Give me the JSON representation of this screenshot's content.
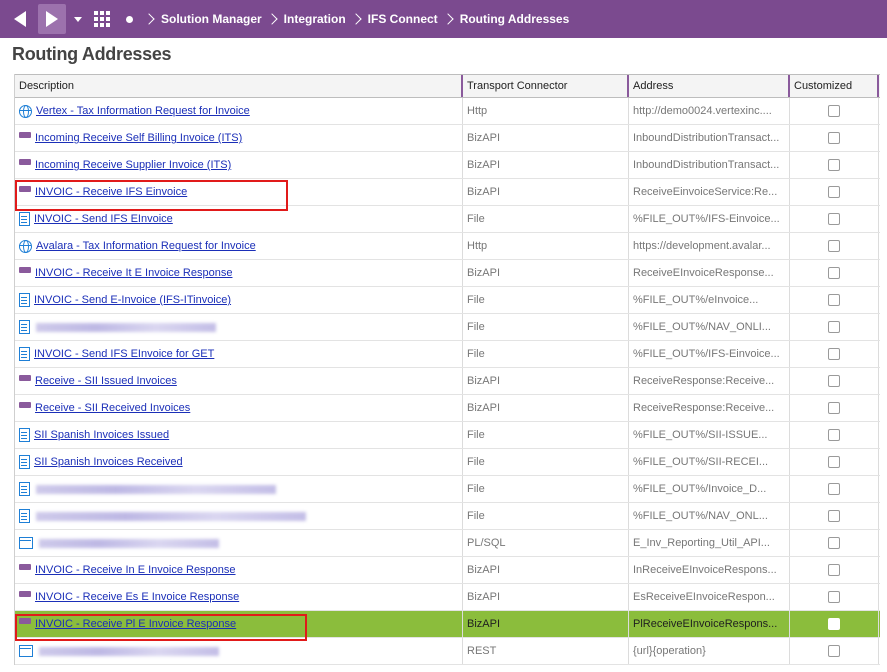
{
  "breadcrumb": [
    "Solution Manager",
    "Integration",
    "IFS Connect",
    "Routing Addresses"
  ],
  "page_title": "Routing Addresses",
  "columns": [
    "Description",
    "Transport Connector",
    "Address",
    "Customized"
  ],
  "rows": [
    {
      "icon": "globe-icon",
      "description": "Vertex - Tax Information Request for Invoice",
      "connector": "Http",
      "address": "http://demo0024.vertexinc...."
    },
    {
      "icon": "message-icon",
      "description": "Incoming Receive Self Billing Invoice (ITS)",
      "connector": "BizAPI",
      "address": "InboundDistributionTransact..."
    },
    {
      "icon": "message-icon",
      "description": "Incoming Receive Supplier Invoice (ITS)",
      "connector": "BizAPI",
      "address": "InboundDistributionTransact..."
    },
    {
      "icon": "message-icon",
      "description": "INVOIC - Receive IFS Einvoice",
      "connector": "BizAPI",
      "address": "ReceiveEinvoiceService:Re..."
    },
    {
      "icon": "file-icon",
      "description": "INVOIC - Send IFS EInvoice",
      "connector": "File",
      "address": "%FILE_OUT%/IFS-Einvoice..."
    },
    {
      "icon": "globe-icon",
      "description": "Avalara - Tax Information Request for Invoice",
      "connector": "Http",
      "address": "https://development.avalar..."
    },
    {
      "icon": "message-icon",
      "description": "INVOIC - Receive It E Invoice Response",
      "connector": "BizAPI",
      "address": "ReceiveEInvoiceResponse..."
    },
    {
      "icon": "file-icon",
      "description": "INVOIC - Send E-Invoice (IFS-ITinvoice)",
      "connector": "File",
      "address": "%FILE_OUT%/eInvoice..."
    },
    {
      "icon": "file-icon",
      "description": "",
      "blurred": true,
      "connector": "File",
      "address": "%FILE_OUT%/NAV_ONLI..."
    },
    {
      "icon": "file-icon",
      "description": "INVOIC - Send IFS EInvoice for GET",
      "connector": "File",
      "address": "%FILE_OUT%/IFS-Einvoice..."
    },
    {
      "icon": "message-icon",
      "description": "Receive - SII Issued Invoices",
      "connector": "BizAPI",
      "address": "ReceiveResponse:Receive..."
    },
    {
      "icon": "message-icon",
      "description": "Receive - SII Received Invoices",
      "connector": "BizAPI",
      "address": "ReceiveResponse:Receive..."
    },
    {
      "icon": "file-icon",
      "description": "SII Spanish Invoices Issued",
      "connector": "File",
      "address": "%FILE_OUT%/SII-ISSUE..."
    },
    {
      "icon": "file-icon",
      "description": "SII Spanish Invoices Received",
      "connector": "File",
      "address": "%FILE_OUT%/SII-RECEI..."
    },
    {
      "icon": "file-icon",
      "description": "",
      "blurred": true,
      "connector": "File",
      "address": "%FILE_OUT%/Invoice_D..."
    },
    {
      "icon": "file-icon",
      "description": "",
      "blurred": true,
      "connector": "File",
      "address": "%FILE_OUT%/NAV_ONL..."
    },
    {
      "icon": "window-icon",
      "description": "",
      "blurred": true,
      "connector": "PL/SQL",
      "address": "E_Inv_Reporting_Util_API..."
    },
    {
      "icon": "message-icon",
      "description": "INVOIC - Receive In E Invoice Response",
      "connector": "BizAPI",
      "address": "InReceiveEInvoiceRespons..."
    },
    {
      "icon": "message-icon",
      "description": "INVOIC - Receive Es E Invoice Response",
      "connector": "BizAPI",
      "address": "EsReceiveEInvoiceRespon..."
    },
    {
      "icon": "message-icon",
      "description": "INVOIC - Receive Pl E Invoice Response",
      "connector": "BizAPI",
      "address": "PlReceiveEInvoiceRespons...",
      "selected": true
    },
    {
      "icon": "window-icon",
      "description": "",
      "blurred": true,
      "connector": "REST",
      "address": "{url}{operation}"
    }
  ],
  "colors": {
    "header_bar": "#7b4a8f",
    "selected_row": "#8bbd3c",
    "link": "#1b2fb8",
    "highlight_box": "#e11a1a"
  }
}
